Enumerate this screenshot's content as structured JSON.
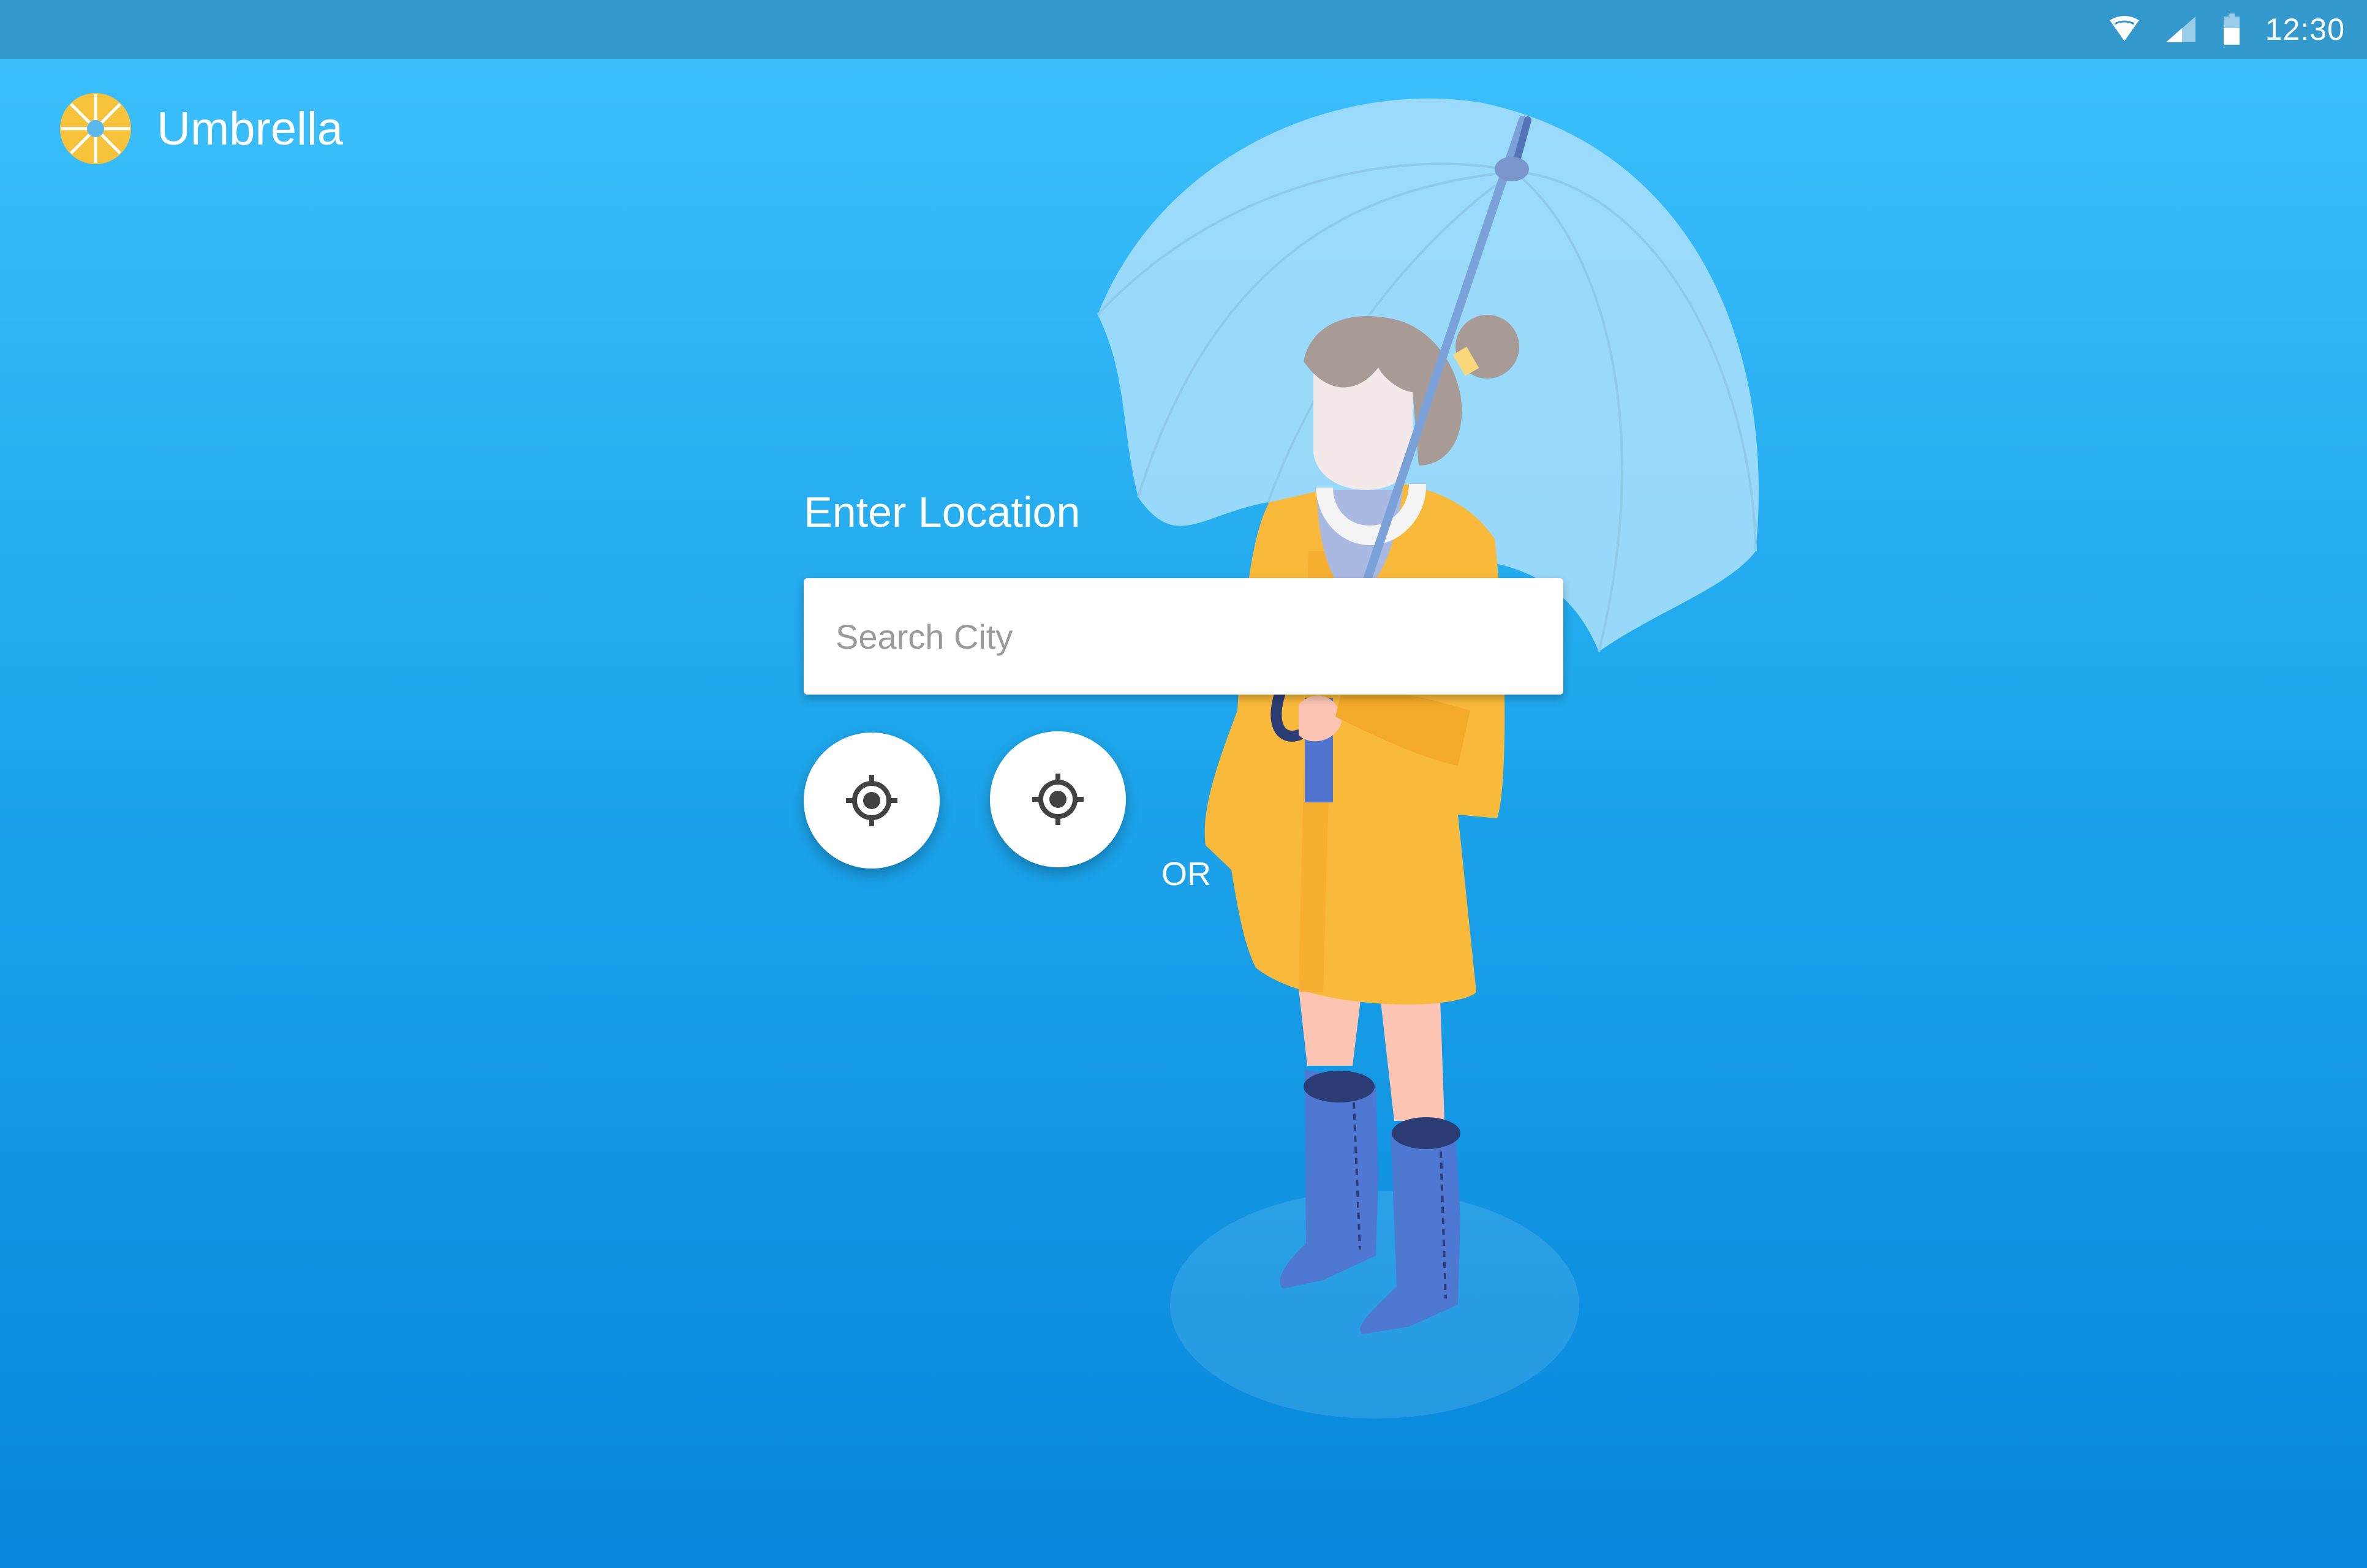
{
  "status_bar": {
    "time": "12:30",
    "icons": [
      "wifi-icon",
      "signal-icon",
      "battery-icon"
    ]
  },
  "app": {
    "title": "Umbrella",
    "logo_icon": "umbrella-logo-icon"
  },
  "location": {
    "heading": "Enter Location",
    "search_placeholder": "Search City",
    "search_value": "",
    "separator": "OR",
    "buttons": [
      {
        "icon": "gps-target-icon"
      },
      {
        "icon": "gps-target-icon"
      }
    ]
  },
  "illustration": {
    "subject": "woman-with-umbrella-illustration"
  },
  "colors": {
    "background_top": "#3ec1fd",
    "background_bottom": "#0886db",
    "status_bar": "#3399cc",
    "raincoat": "#f9b93a",
    "boots": "#4f78d2",
    "umbrella": "#a8ddfb"
  }
}
